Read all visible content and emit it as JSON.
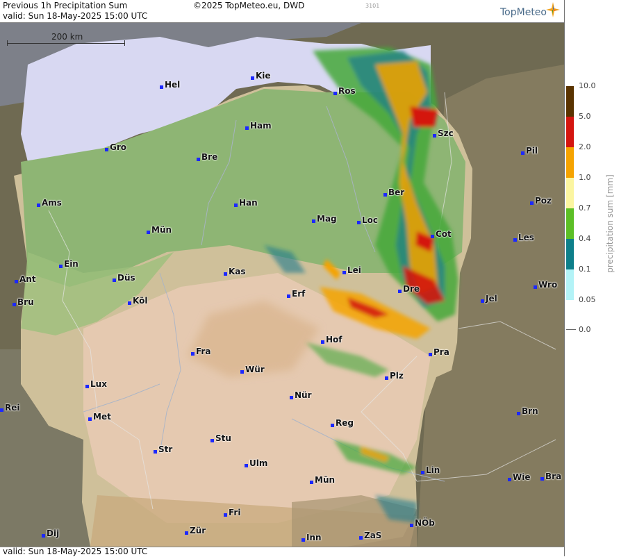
{
  "header": {
    "title": "Previous 1h Precipitation Sum",
    "valid": "valid:  Sun  18-May-2025 15:00 UTC",
    "copyright": "©2025 TopMeteo.eu, DWD",
    "code": "3101",
    "logo": "TopMeteo"
  },
  "footer": {
    "valid": "valid:  Sun  18-May-2025 15:00 UTC"
  },
  "scale": {
    "label": "200 km"
  },
  "legend": {
    "title": "precipitation sum [mm]",
    "levels": [
      {
        "label": "10.0",
        "color": "#5a3300"
      },
      {
        "label": "5.0",
        "color": "#d4150f"
      },
      {
        "label": "2.0",
        "color": "#f5a300"
      },
      {
        "label": "1.0",
        "color": "#fbf5a0"
      },
      {
        "label": "0.7",
        "color": "#5cbf26"
      },
      {
        "label": "0.4",
        "color": "#0d7f8a"
      },
      {
        "label": "0.1",
        "color": "#b3f3f7"
      },
      {
        "label": "0.05",
        "color": "#ffffff"
      },
      {
        "label": "0.0",
        "color": "#ffffff"
      }
    ]
  },
  "cities": [
    {
      "name": "Kie"
    },
    {
      "name": "Hel"
    },
    {
      "name": "Ros"
    },
    {
      "name": "Ham"
    },
    {
      "name": "Szc"
    },
    {
      "name": "Gro"
    },
    {
      "name": "Bre"
    },
    {
      "name": "Pil"
    },
    {
      "name": "Ber"
    },
    {
      "name": "Ams"
    },
    {
      "name": "Han"
    },
    {
      "name": "Poz"
    },
    {
      "name": "Mag"
    },
    {
      "name": "Loc"
    },
    {
      "name": "Mün"
    },
    {
      "name": "Cot"
    },
    {
      "name": "Les"
    },
    {
      "name": "Ein"
    },
    {
      "name": "Lei"
    },
    {
      "name": "Kas"
    },
    {
      "name": "Ant"
    },
    {
      "name": "Düs"
    },
    {
      "name": "Wro"
    },
    {
      "name": "Dre"
    },
    {
      "name": "Erf"
    },
    {
      "name": "Bru"
    },
    {
      "name": "Köl"
    },
    {
      "name": "Jel"
    },
    {
      "name": "Hof"
    },
    {
      "name": "Fra"
    },
    {
      "name": "Pra"
    },
    {
      "name": "Wür"
    },
    {
      "name": "Plz"
    },
    {
      "name": "Lux"
    },
    {
      "name": "Nür"
    },
    {
      "name": "Rei"
    },
    {
      "name": "Met"
    },
    {
      "name": "Brn"
    },
    {
      "name": "Reg"
    },
    {
      "name": "Stu"
    },
    {
      "name": "Str"
    },
    {
      "name": "Ulm"
    },
    {
      "name": "Lin"
    },
    {
      "name": "Wie"
    },
    {
      "name": "Bra"
    },
    {
      "name": "Mün"
    },
    {
      "name": "Fri"
    },
    {
      "name": "NÖb"
    },
    {
      "name": "Dij"
    },
    {
      "name": "Zür"
    },
    {
      "name": "Inn"
    },
    {
      "name": "ZaS"
    }
  ]
}
